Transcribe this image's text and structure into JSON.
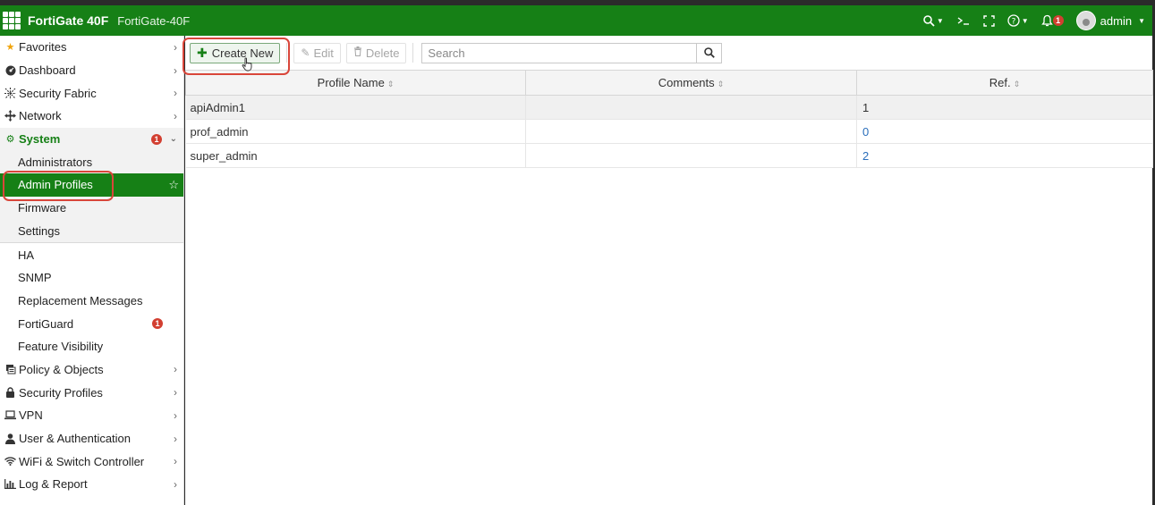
{
  "header": {
    "brand": "FortiGate 40F",
    "device_name": "FortiGate-40F",
    "alert_count": "1",
    "user": "admin",
    "color": "#168016"
  },
  "sidebar": {
    "items": [
      {
        "label": "Favorites",
        "icon": "star-icon"
      },
      {
        "label": "Dashboard",
        "icon": "dashboard-icon"
      },
      {
        "label": "Security Fabric",
        "icon": "fabric-icon"
      },
      {
        "label": "Network",
        "icon": "network-icon"
      },
      {
        "label": "System",
        "icon": "gear-icon",
        "badge": "1"
      },
      {
        "label": "Administrators"
      },
      {
        "label": "Admin Profiles"
      },
      {
        "label": "Firmware"
      },
      {
        "label": "Settings"
      },
      {
        "label": "HA"
      },
      {
        "label": "SNMP"
      },
      {
        "label": "Replacement Messages"
      },
      {
        "label": "FortiGuard",
        "badge": "1"
      },
      {
        "label": "Feature Visibility"
      },
      {
        "label": "Policy & Objects",
        "icon": "policy-icon"
      },
      {
        "label": "Security Profiles",
        "icon": "lock-icon"
      },
      {
        "label": "VPN",
        "icon": "laptop-icon"
      },
      {
        "label": "User & Authentication",
        "icon": "user-icon"
      },
      {
        "label": "WiFi & Switch Controller",
        "icon": "wifi-icon"
      },
      {
        "label": "Log & Report",
        "icon": "chart-icon"
      }
    ]
  },
  "toolbar": {
    "create_label": "Create New",
    "edit_label": "Edit",
    "delete_label": "Delete",
    "search_placeholder": "Search"
  },
  "table": {
    "columns": [
      "Profile Name",
      "Comments",
      "Ref."
    ],
    "rows": [
      {
        "name": "apiAdmin1",
        "comments": "",
        "ref": "1"
      },
      {
        "name": "prof_admin",
        "comments": "",
        "ref": "0"
      },
      {
        "name": "super_admin",
        "comments": "",
        "ref": "2"
      }
    ]
  }
}
